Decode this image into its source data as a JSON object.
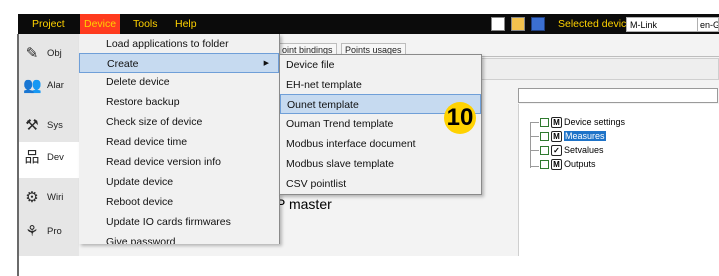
{
  "menubar": {
    "items": [
      {
        "label": "Project"
      },
      {
        "label": "Device"
      },
      {
        "label": "Tools"
      },
      {
        "label": "Help"
      }
    ],
    "selected_device_label": "Selected device:",
    "selected_device_value": "M-Link",
    "language_value": "en-GB"
  },
  "toolbar": {
    "icons": [
      "new-file-icon",
      "open-folder-icon",
      "save-icon"
    ]
  },
  "sidebar": {
    "items": [
      {
        "label": "Obj",
        "icon": "pencil-icon"
      },
      {
        "label": "Alar",
        "icon": "users-icon"
      },
      {
        "label": "Sys",
        "icon": "tools-icon"
      },
      {
        "label": "Dev",
        "icon": "network-icon"
      },
      {
        "label": "Wiri",
        "icon": "wiring-icon"
      },
      {
        "label": "Pro",
        "icon": "protocol-icon"
      }
    ]
  },
  "tabs": [
    {
      "label": "oint bindings"
    },
    {
      "label": "Points usages"
    }
  ],
  "device_menu": {
    "items": [
      {
        "label": "Load applications to folder"
      },
      {
        "label": "Create"
      },
      {
        "label": "Delete device"
      },
      {
        "label": "Restore backup"
      },
      {
        "label": "Check size of device"
      },
      {
        "label": "Read device time"
      },
      {
        "label": "Read device version info"
      },
      {
        "label": "Update device"
      },
      {
        "label": "Reboot device"
      },
      {
        "label": "Update IO cards firmwares"
      },
      {
        "label": "Give password"
      }
    ]
  },
  "create_submenu": {
    "items": [
      {
        "label": "Device file"
      },
      {
        "label": "EH-net template"
      },
      {
        "label": "Ounet template"
      },
      {
        "label": "Ouman Trend template"
      },
      {
        "label": "Modbus interface document"
      },
      {
        "label": "Modbus slave template"
      },
      {
        "label": "CSV pointlist"
      }
    ]
  },
  "tree": {
    "nodes": [
      {
        "label": "Device settings",
        "badge": "M"
      },
      {
        "label": "Measures",
        "badge": "M"
      },
      {
        "label": "Setvalues",
        "badge": "✓"
      },
      {
        "label": "Outputs",
        "badge": "M"
      }
    ]
  },
  "main": {
    "partial_text": "P master"
  },
  "step_badge": "10",
  "colors": {
    "menubar_bg": "#0b0b0b",
    "menubar_text": "#ffd200",
    "menu_active": "#ff3b1e",
    "highlight": "#c6daf0",
    "tree_selected": "#1e73c8",
    "badge": "#ffd200"
  }
}
